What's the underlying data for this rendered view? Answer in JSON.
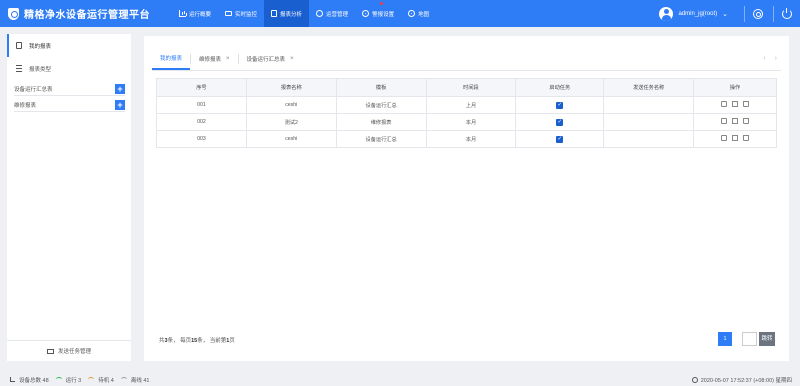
{
  "app": {
    "title": "精格净水设备运行管理平台"
  },
  "nav": [
    {
      "label": "运行概要",
      "icon": "bar-chart-icon",
      "active": false
    },
    {
      "label": "实时监控",
      "icon": "monitor-icon",
      "active": false
    },
    {
      "label": "报表分析",
      "icon": "report-icon",
      "active": true
    },
    {
      "label": "运营管理",
      "icon": "user-manage-icon",
      "active": false
    },
    {
      "label": "警报设置",
      "icon": "alarm-gear-icon",
      "active": false,
      "badge": true
    },
    {
      "label": "地图",
      "icon": "globe-icon",
      "active": false
    }
  ],
  "user": {
    "name": "admin_jg(root)"
  },
  "sidebar": {
    "items": [
      {
        "label": "我的报表",
        "active": true
      },
      {
        "label": "报表类型",
        "active": false
      }
    ],
    "groups": [
      {
        "label": "设备运行汇总表"
      },
      {
        "label": "维修报表"
      }
    ],
    "footer": "发送任务管理"
  },
  "tabs": [
    {
      "label": "我的报表",
      "active": true,
      "closable": false
    },
    {
      "label": "维修报表",
      "active": false,
      "closable": true
    },
    {
      "label": "设备运行汇总表",
      "active": false,
      "closable": true
    }
  ],
  "table": {
    "headers": [
      "序号",
      "报表名称",
      "模板",
      "时间段",
      "启动任务",
      "发送任务名称",
      "操作"
    ],
    "rows": [
      {
        "no": "001",
        "name": "ceshi",
        "template": "设备运行汇总",
        "period": "上月",
        "enabled": true,
        "send_task": ""
      },
      {
        "no": "002",
        "name": "测试2",
        "template": "维修报表",
        "period": "本月",
        "enabled": true,
        "send_task": ""
      },
      {
        "no": "003",
        "name": "ceshi",
        "template": "设备运行汇总",
        "period": "本月",
        "enabled": true,
        "send_task": ""
      }
    ]
  },
  "pagination": {
    "prefix": "共",
    "total": "3",
    "total_suffix": "条，  每页",
    "per_page": "15",
    "per_page_suffix": "条，  当前第",
    "current": "1",
    "current_suffix": "页",
    "page_button": "1",
    "jump_label": "跳转"
  },
  "status": {
    "total": "设备总数 48",
    "running": "运行 3",
    "standby": "待机 4",
    "offline": "离线 41",
    "datetime": "2020-05-07 17:52:37 (+08:00) 星期四"
  }
}
